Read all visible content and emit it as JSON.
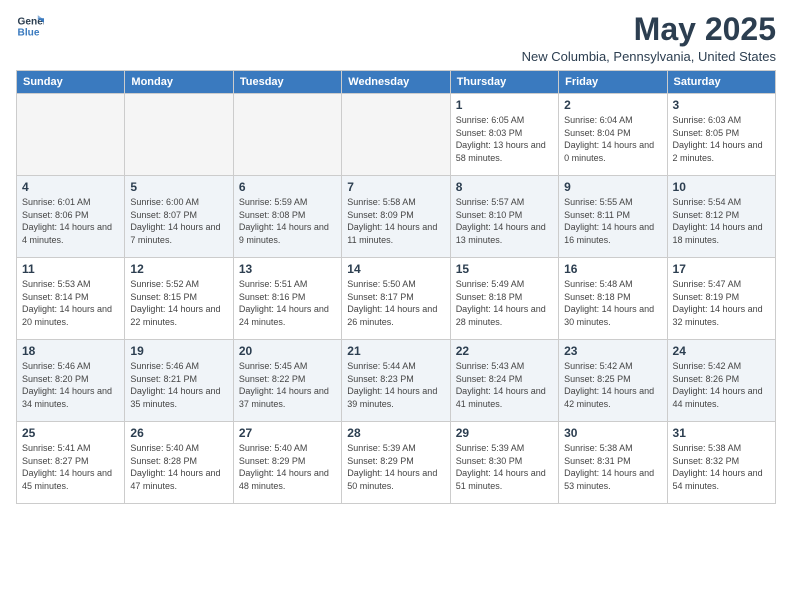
{
  "logo": {
    "line1": "General",
    "line2": "Blue"
  },
  "title": "May 2025",
  "location": "New Columbia, Pennsylvania, United States",
  "days_of_week": [
    "Sunday",
    "Monday",
    "Tuesday",
    "Wednesday",
    "Thursday",
    "Friday",
    "Saturday"
  ],
  "weeks": [
    [
      {
        "day": "",
        "empty": true
      },
      {
        "day": "",
        "empty": true
      },
      {
        "day": "",
        "empty": true
      },
      {
        "day": "",
        "empty": true
      },
      {
        "day": "1",
        "sunrise": "6:05 AM",
        "sunset": "8:03 PM",
        "daylight": "13 hours and 58 minutes."
      },
      {
        "day": "2",
        "sunrise": "6:04 AM",
        "sunset": "8:04 PM",
        "daylight": "14 hours and 0 minutes."
      },
      {
        "day": "3",
        "sunrise": "6:03 AM",
        "sunset": "8:05 PM",
        "daylight": "14 hours and 2 minutes."
      }
    ],
    [
      {
        "day": "4",
        "sunrise": "6:01 AM",
        "sunset": "8:06 PM",
        "daylight": "14 hours and 4 minutes."
      },
      {
        "day": "5",
        "sunrise": "6:00 AM",
        "sunset": "8:07 PM",
        "daylight": "14 hours and 7 minutes."
      },
      {
        "day": "6",
        "sunrise": "5:59 AM",
        "sunset": "8:08 PM",
        "daylight": "14 hours and 9 minutes."
      },
      {
        "day": "7",
        "sunrise": "5:58 AM",
        "sunset": "8:09 PM",
        "daylight": "14 hours and 11 minutes."
      },
      {
        "day": "8",
        "sunrise": "5:57 AM",
        "sunset": "8:10 PM",
        "daylight": "14 hours and 13 minutes."
      },
      {
        "day": "9",
        "sunrise": "5:55 AM",
        "sunset": "8:11 PM",
        "daylight": "14 hours and 16 minutes."
      },
      {
        "day": "10",
        "sunrise": "5:54 AM",
        "sunset": "8:12 PM",
        "daylight": "14 hours and 18 minutes."
      }
    ],
    [
      {
        "day": "11",
        "sunrise": "5:53 AM",
        "sunset": "8:14 PM",
        "daylight": "14 hours and 20 minutes."
      },
      {
        "day": "12",
        "sunrise": "5:52 AM",
        "sunset": "8:15 PM",
        "daylight": "14 hours and 22 minutes."
      },
      {
        "day": "13",
        "sunrise": "5:51 AM",
        "sunset": "8:16 PM",
        "daylight": "14 hours and 24 minutes."
      },
      {
        "day": "14",
        "sunrise": "5:50 AM",
        "sunset": "8:17 PM",
        "daylight": "14 hours and 26 minutes."
      },
      {
        "day": "15",
        "sunrise": "5:49 AM",
        "sunset": "8:18 PM",
        "daylight": "14 hours and 28 minutes."
      },
      {
        "day": "16",
        "sunrise": "5:48 AM",
        "sunset": "8:18 PM",
        "daylight": "14 hours and 30 minutes."
      },
      {
        "day": "17",
        "sunrise": "5:47 AM",
        "sunset": "8:19 PM",
        "daylight": "14 hours and 32 minutes."
      }
    ],
    [
      {
        "day": "18",
        "sunrise": "5:46 AM",
        "sunset": "8:20 PM",
        "daylight": "14 hours and 34 minutes."
      },
      {
        "day": "19",
        "sunrise": "5:46 AM",
        "sunset": "8:21 PM",
        "daylight": "14 hours and 35 minutes."
      },
      {
        "day": "20",
        "sunrise": "5:45 AM",
        "sunset": "8:22 PM",
        "daylight": "14 hours and 37 minutes."
      },
      {
        "day": "21",
        "sunrise": "5:44 AM",
        "sunset": "8:23 PM",
        "daylight": "14 hours and 39 minutes."
      },
      {
        "day": "22",
        "sunrise": "5:43 AM",
        "sunset": "8:24 PM",
        "daylight": "14 hours and 41 minutes."
      },
      {
        "day": "23",
        "sunrise": "5:42 AM",
        "sunset": "8:25 PM",
        "daylight": "14 hours and 42 minutes."
      },
      {
        "day": "24",
        "sunrise": "5:42 AM",
        "sunset": "8:26 PM",
        "daylight": "14 hours and 44 minutes."
      }
    ],
    [
      {
        "day": "25",
        "sunrise": "5:41 AM",
        "sunset": "8:27 PM",
        "daylight": "14 hours and 45 minutes."
      },
      {
        "day": "26",
        "sunrise": "5:40 AM",
        "sunset": "8:28 PM",
        "daylight": "14 hours and 47 minutes."
      },
      {
        "day": "27",
        "sunrise": "5:40 AM",
        "sunset": "8:29 PM",
        "daylight": "14 hours and 48 minutes."
      },
      {
        "day": "28",
        "sunrise": "5:39 AM",
        "sunset": "8:29 PM",
        "daylight": "14 hours and 50 minutes."
      },
      {
        "day": "29",
        "sunrise": "5:39 AM",
        "sunset": "8:30 PM",
        "daylight": "14 hours and 51 minutes."
      },
      {
        "day": "30",
        "sunrise": "5:38 AM",
        "sunset": "8:31 PM",
        "daylight": "14 hours and 53 minutes."
      },
      {
        "day": "31",
        "sunrise": "5:38 AM",
        "sunset": "8:32 PM",
        "daylight": "14 hours and 54 minutes."
      }
    ]
  ],
  "labels": {
    "sunrise_prefix": "Sunrise: ",
    "sunset_prefix": "Sunset: ",
    "daylight_prefix": "Daylight: "
  }
}
